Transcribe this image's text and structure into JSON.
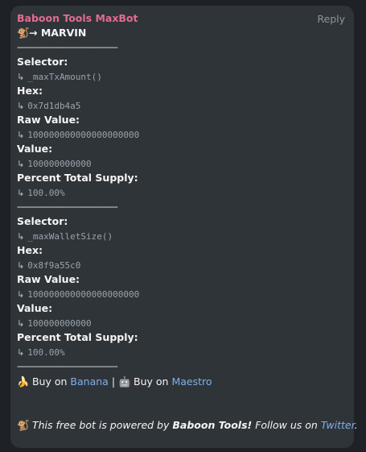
{
  "message": {
    "sender": "Baboon Tools MaxBot",
    "reply_label": "Reply",
    "monkey_emoji": "🐒",
    "title_arrow": "→",
    "token_name": "MARVIN",
    "separator": "------------------------------------------",
    "sub_arrow": "↳",
    "labels": {
      "selector": "Selector:",
      "hex": "Hex:",
      "raw_value": "Raw Value:",
      "value": "Value:",
      "percent": "Percent Total Supply:"
    },
    "entries": [
      {
        "selector": "_maxTxAmount()",
        "hex": "0x7d1db4a5",
        "raw_value": "100000000000000000000",
        "value": "100000000000",
        "percent": "100.00%"
      },
      {
        "selector": "_maxWalletSize()",
        "hex": "0x8f9a55c0",
        "raw_value": "100000000000000000000",
        "value": "100000000000",
        "percent": "100.00%"
      }
    ],
    "buy": {
      "banana_emoji": "🍌",
      "buy_on_1": "Buy on",
      "link_1": "Banana",
      "divider": "|",
      "robot_emoji": "🤖",
      "buy_on_2": "Buy on",
      "link_2": "Maestro"
    },
    "footer": {
      "emoji": "🐒",
      "text_1": "This free bot is powered by",
      "brand": "Baboon Tools!",
      "text_2": "Follow us on",
      "link": "Twitter",
      "end": "."
    }
  },
  "colors": {
    "background": "#1e2125",
    "bubble": "#2f3439",
    "sender": "#e46b8e",
    "link": "#7eb1e8",
    "muted": "#9aa3aa"
  }
}
